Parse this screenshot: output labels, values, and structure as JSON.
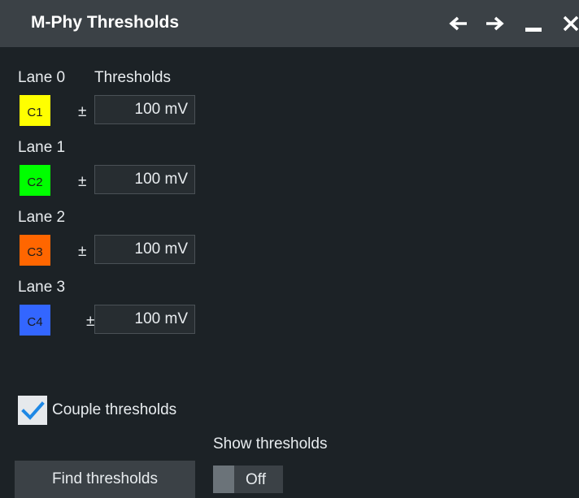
{
  "window": {
    "title": "M-Phy Thresholds",
    "icons": [
      "arrow-left-icon",
      "arrow-right-icon",
      "minimize-icon",
      "close-icon"
    ]
  },
  "header": {
    "thresholds_label": "Thresholds"
  },
  "lanes": [
    {
      "label": "Lane 0",
      "channel": "C1",
      "color": "#ffff00",
      "symbol": "±",
      "value": "100 mV"
    },
    {
      "label": "Lane 1",
      "channel": "C2",
      "color": "#00ff00",
      "symbol": "±",
      "value": "100 mV"
    },
    {
      "label": "Lane 2",
      "channel": "C3",
      "color": "#ff6600",
      "symbol": "±",
      "value": "100 mV"
    },
    {
      "label": "Lane 3",
      "channel": "C4",
      "color": "#3366ff",
      "symbol": "±",
      "value": "100 mV"
    }
  ],
  "couple": {
    "label": "Couple thresholds",
    "checked": true,
    "check_color": "#1e88e5"
  },
  "show_thresholds": {
    "label": "Show thresholds",
    "state": "Off"
  },
  "find_button": {
    "label": "Find thresholds"
  }
}
